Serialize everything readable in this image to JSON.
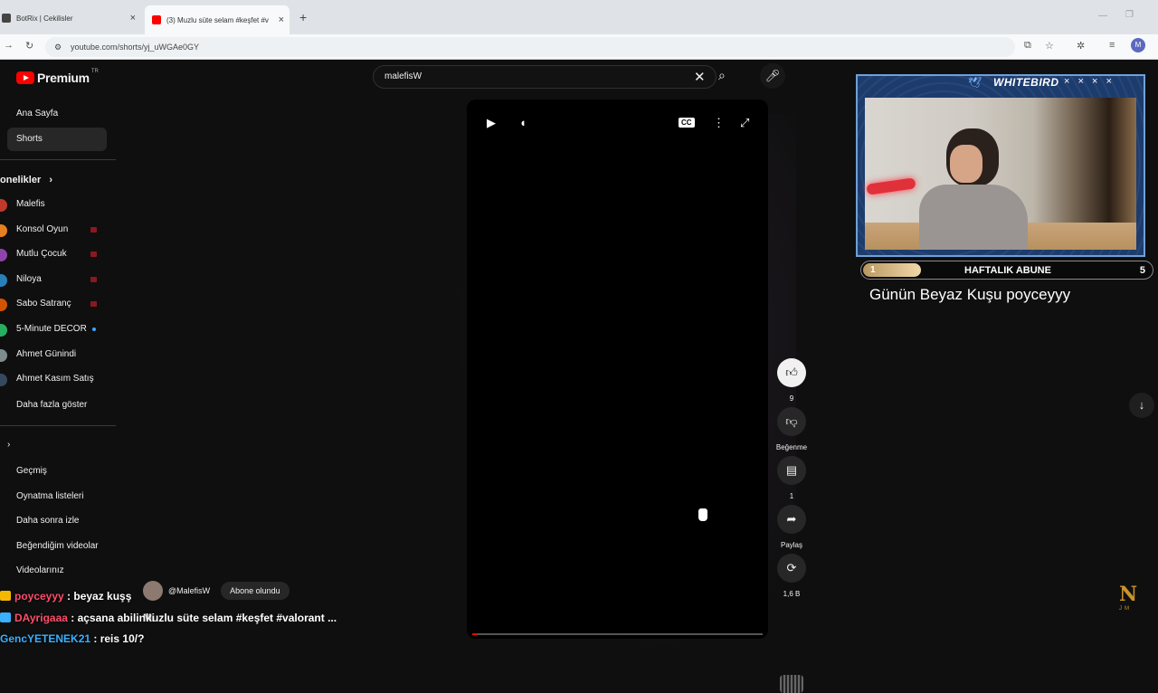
{
  "browser": {
    "tabs": [
      {
        "title": "BotRix | Cekilisler",
        "close": "×"
      },
      {
        "title": "(3) Muzlu süte selam #keşfet #v",
        "close": "×"
      }
    ],
    "new_tab": "+",
    "url": "youtube.com/shorts/yj_uWGAe0GY",
    "profile_initial": "M"
  },
  "youtube": {
    "logo_text": "Premium",
    "logo_region": "TR",
    "search_value": "malefisW",
    "nav": [
      {
        "label": "Ana Sayfa",
        "selected": false
      },
      {
        "label": "Shorts",
        "selected": true
      }
    ],
    "subscriptions_header": "onelikler",
    "subscriptions": [
      {
        "label": "Malefis",
        "color": "#c0392b",
        "live": false,
        "new": false
      },
      {
        "label": "Konsol Oyun",
        "color": "#e67e22",
        "live": true,
        "new": false
      },
      {
        "label": "Mutlu Çocuk",
        "color": "#8e44ad",
        "live": true,
        "new": false
      },
      {
        "label": "Niloya",
        "color": "#2980b9",
        "live": true,
        "new": false
      },
      {
        "label": "Sabo Satranç",
        "color": "#d35400",
        "live": true,
        "new": false
      },
      {
        "label": "5-Minute DECOR",
        "color": "#27ae60",
        "live": false,
        "new": true
      },
      {
        "label": "Ahmet Günindi",
        "color": "#7f8c8d",
        "live": false,
        "new": false
      },
      {
        "label": "Ahmet Kasım Satış",
        "color": "#34495e",
        "live": false,
        "new": false
      }
    ],
    "show_more": "Daha fazla göster",
    "you_items": [
      "Geçmiş",
      "Oynatma listeleri",
      "Daha sonra izle",
      "Beğendiğim videolar",
      "Videolarınız"
    ],
    "actions": {
      "like_count": "9",
      "dislike_label": "Beğenme",
      "comment_count": "1",
      "share_label": "Paylaş",
      "remix_count": "1,6 B"
    },
    "channel_handle": "@MalefisW",
    "subscribe_label": "Abone olundu",
    "short_caption": "Muzlu süte selam #keşfet #valorant ...",
    "progress_fraction": 0.02
  },
  "stream_overlay": {
    "brand": "WHITEBIRD",
    "brand_controls": "× × × ×",
    "weekly_goal_label": "HAFTALIK ABUNE",
    "weekly_goal_start": "1",
    "weekly_goal_end": "5",
    "weekly_goal_progress": 0.2,
    "bird_of_day": "Günün Beyaz Kuşu poyceyyy",
    "logo_letter": "N",
    "logo_sub": "JM"
  },
  "chat": [
    {
      "user": "poyceyyy",
      "message": " : beyaz kuşş",
      "badge": "#f5b800",
      "user_style": "red"
    },
    {
      "user": "DAyrigaaa",
      "message": " : açsana abilinki",
      "badge": "#3ab0ff",
      "user_style": "red"
    },
    {
      "user": "GencYETENEK21",
      "message": " : reis 10/?",
      "badge": "",
      "user_style": "blue"
    }
  ]
}
